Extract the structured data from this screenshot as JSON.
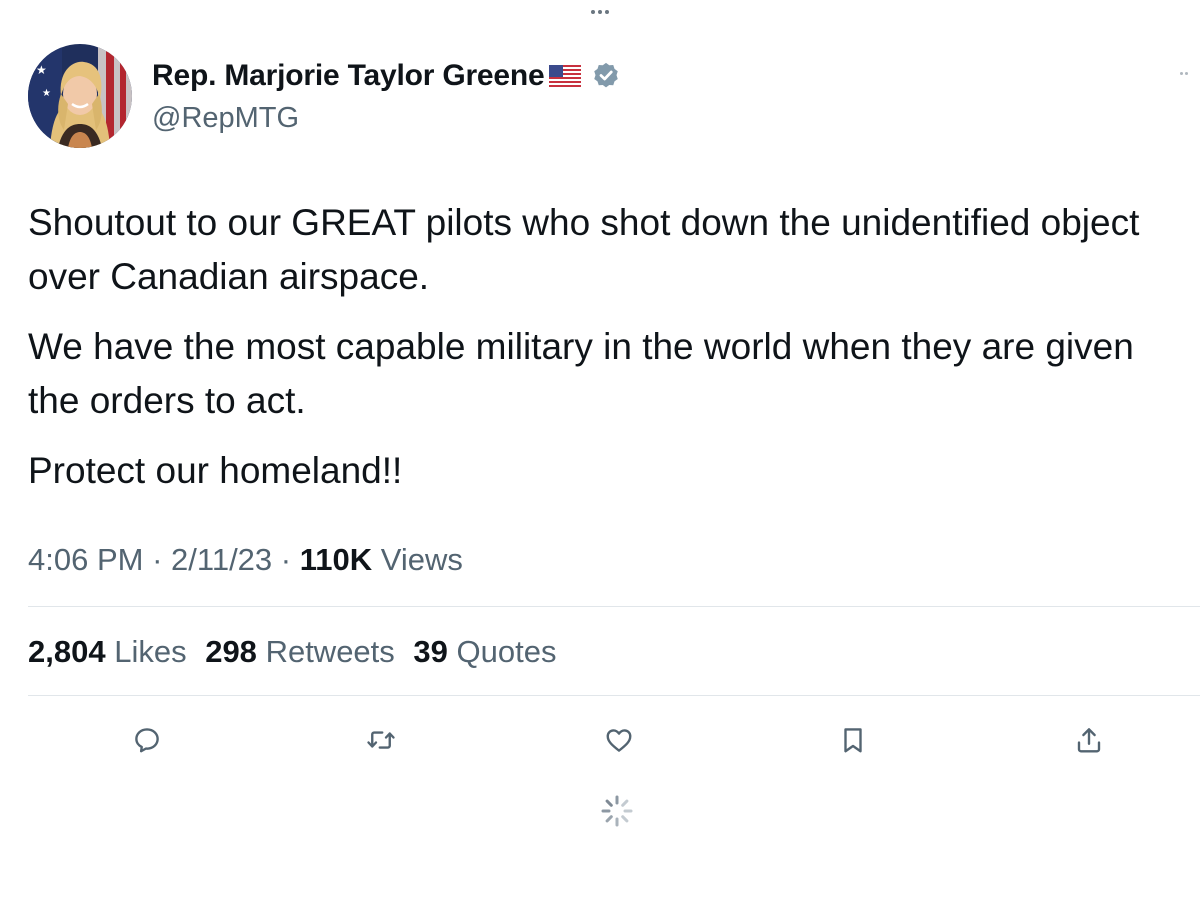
{
  "top_handle": {
    "icon": "more-dots-icon"
  },
  "author": {
    "display_name": "Rep. Marjorie Taylor Greene",
    "flag_emoji": "us-flag-icon",
    "verified_icon": "verified-badge-icon",
    "handle": "@RepMTG"
  },
  "tweet": {
    "paragraphs": [
      "Shoutout to our GREAT pilots who shot down the unidentified object over Canadian airspace.",
      "We have the most capable military in the world when they are given the orders to act.",
      "Protect our homeland!!"
    ]
  },
  "meta": {
    "time": "4:06 PM",
    "separator": "·",
    "date": "2/11/23",
    "views_count": "110K",
    "views_label": "Views"
  },
  "stats": {
    "likes_count": "2,804",
    "likes_label": "Likes",
    "retweets_count": "298",
    "retweets_label": "Retweets",
    "quotes_count": "39",
    "quotes_label": "Quotes"
  },
  "actions": [
    {
      "name": "reply",
      "icon": "reply-icon"
    },
    {
      "name": "retweet",
      "icon": "retweet-icon"
    },
    {
      "name": "like",
      "icon": "heart-icon"
    },
    {
      "name": "bookmark",
      "icon": "bookmark-icon"
    },
    {
      "name": "share",
      "icon": "share-icon"
    }
  ],
  "colors": {
    "text_primary": "#0f1419",
    "text_secondary": "#536471",
    "verified_badge": "#829aab",
    "divider": "#e1e6ea"
  },
  "loading": {
    "icon": "loading-spinner-icon"
  }
}
